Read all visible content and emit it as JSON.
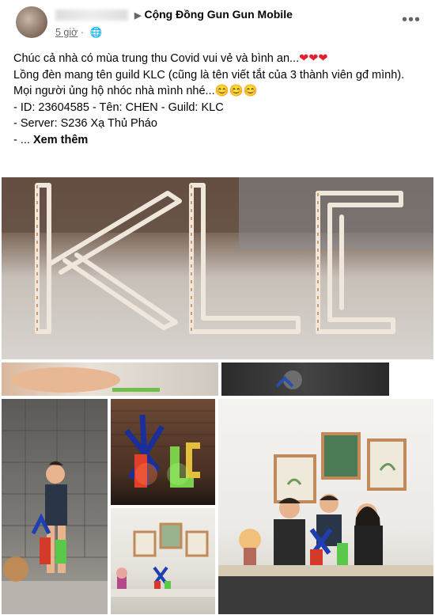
{
  "post": {
    "author_prefix": "vÕ TH LỴ",
    "group_name": "Cộng Đồng Gun Gun Mobile",
    "time": "5 giờ",
    "privacy_icon": "globe-icon",
    "more_icon": "more-options-icon",
    "lines": {
      "l1": "Chúc cả nhà có mùa trung thu Covid vui vẻ và bình an...",
      "l2": "Lồng đèn mang tên guild KLC (cũng là tên viết tắt của 3 thành viên gđ mình).",
      "l3": "Mọi người ủng hộ nhóc nhà mình nhé...",
      "l4": "- ID: 23604585 - Tên: CHEN - Guild: KLC",
      "l5": "- Server: S236 Xạ Thủ Pháo",
      "l6_prefix": "- ... ",
      "see_more": "Xem thêm"
    },
    "emoji": {
      "hearts": "❤❤❤",
      "smiles": "😊😊😊"
    }
  },
  "photos": {
    "main_letters": "KLC",
    "lantern_letters": "KLC"
  }
}
